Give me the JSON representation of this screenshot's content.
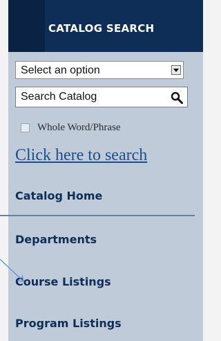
{
  "header": {
    "title": "CATALOG SEARCH"
  },
  "search": {
    "select_label": "Select an option",
    "input_placeholder": "Search Catalog",
    "checkbox_label": "Whole Word/Phrase",
    "link_label": "Click here to search"
  },
  "nav": {
    "items": [
      {
        "label": "Catalog Home"
      },
      {
        "label": "Departments"
      },
      {
        "label": "Course Listings"
      },
      {
        "label": "Program Listings"
      }
    ]
  },
  "icons": {
    "search": "search-icon",
    "dropdown": "chevron-down-icon"
  },
  "colors": {
    "header_bg": "#0f2e57",
    "panel_bg": "#bfcbd8",
    "nav_text": "#0f2e57",
    "link": "#1c4e8c"
  }
}
